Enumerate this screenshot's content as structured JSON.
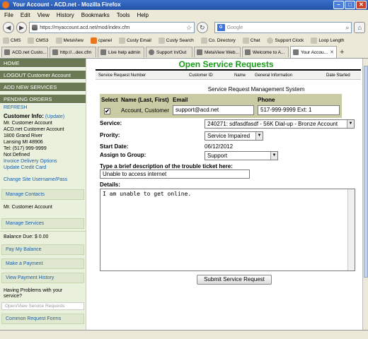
{
  "browser": {
    "title": "Your Account - ACD.net - Mozilla Firefox",
    "menu": [
      "File",
      "Edit",
      "View",
      "History",
      "Bookmarks",
      "Tools",
      "Help"
    ],
    "url": "https://myaccount.acd.net/mod/index.cfm",
    "search_placeholder": "Google",
    "bookmarks": [
      "CMS",
      "CMS3",
      "MetaView",
      "cpanel",
      "Custy Email",
      "Custy Search",
      "Co. Directory",
      "Chat",
      "Support Clock",
      "Loop Length"
    ],
    "tabs": [
      "ACD.net Custo...",
      "http://...dex.cfm",
      "Live help admin",
      "Support In/Out",
      "MetaView Web...",
      "Welcome to A...",
      "Your Accou..."
    ]
  },
  "sidebar": {
    "home": "HOME",
    "logout": "LOGOUT Customer Account",
    "add_services": "ADD NEW SERVICES",
    "pending_orders": "PENDING ORDERS",
    "refresh": "REFRESH",
    "customer_info_label": "Customer Info:",
    "update_link": "(Update)",
    "customer_lines": [
      "Mr. Customer Account",
      "ACD.net Customer Account",
      "1800 Grand River",
      "Lansing MI 48906",
      "Tel: (517) 999-9999",
      "Not Defined"
    ],
    "invoice_link": "Invoice Delivery Options",
    "card_link": "Update Credit Card",
    "change_link": "Change Site Username/Pass",
    "manage_contacts": "Manage Contacts",
    "contact_name": "Mr. Customer Account",
    "manage_services": "Manage Services",
    "balance": "Balance Due: $ 0.00",
    "pay_balance": "Pay My Balance",
    "make_payment": "Make a Payment",
    "view_history": "View Payment History",
    "problems_text": "Having Problems with your service?",
    "open_view": "Open/View Service Requests",
    "common_forms": "Common Request Forms"
  },
  "main": {
    "page_title": "Open Service Requests",
    "columns": [
      "Service Request Number",
      "Customer ID",
      "Name",
      "General Information",
      "Date Started"
    ],
    "section_title": "Service Request Management System",
    "select_label": "Select",
    "name_label": "Name (Last, First)",
    "email_label": "Email",
    "phone_label": "Phone",
    "account_name": "Account, Customer",
    "email_value": "support@acd.net",
    "phone_value": "517-999-9999 Ext: 1",
    "checkbox_mark": "✔",
    "service_label": "Service:",
    "service_value": "240271: sdfasdfasdf - 56K Dial-up - Bronze Account",
    "priority_label": "Prority:",
    "priority_value": "Service Impaired",
    "start_label": "Start Date:",
    "start_value": "06/12/2012",
    "assign_label": "Assign to Group:",
    "assign_value": "Support",
    "brief_label": "Type a brief description of the trouble ticket here:",
    "brief_value": "Unable to access internet",
    "details_label": "Details:",
    "details_value": "I am unable to get online.",
    "submit_label": "Submit Service Request"
  }
}
